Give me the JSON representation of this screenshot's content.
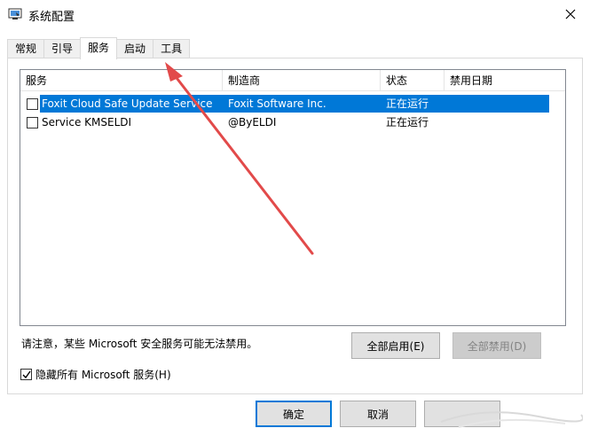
{
  "window": {
    "title": "系统配置"
  },
  "tabs": [
    {
      "label": "常规",
      "active": false
    },
    {
      "label": "引导",
      "active": false
    },
    {
      "label": "服务",
      "active": true
    },
    {
      "label": "启动",
      "active": false
    },
    {
      "label": "工具",
      "active": false
    }
  ],
  "services": {
    "columns": [
      "服务",
      "制造商",
      "状态",
      "禁用日期"
    ],
    "rows": [
      {
        "name": "Foxit Cloud Safe Update Service",
        "vendor": "Foxit Software Inc.",
        "status": "正在运行",
        "date": "",
        "checked": false,
        "selected": true
      },
      {
        "name": "Service KMSELDI",
        "vendor": "@ByELDI",
        "status": "正在运行",
        "date": "",
        "checked": false,
        "selected": false
      }
    ]
  },
  "note": "请注意，某些 Microsoft 安全服务可能无法禁用。",
  "buttons": {
    "enable_all": "全部启用(E)",
    "disable_all": "全部禁用(D)",
    "ok": "确定",
    "cancel": "取消"
  },
  "hide_ms": {
    "label": "隐藏所有 Microsoft 服务(H)",
    "checked": true
  },
  "colors": {
    "selection": "#0078d7",
    "annotation_arrow": "#e24a4a"
  }
}
